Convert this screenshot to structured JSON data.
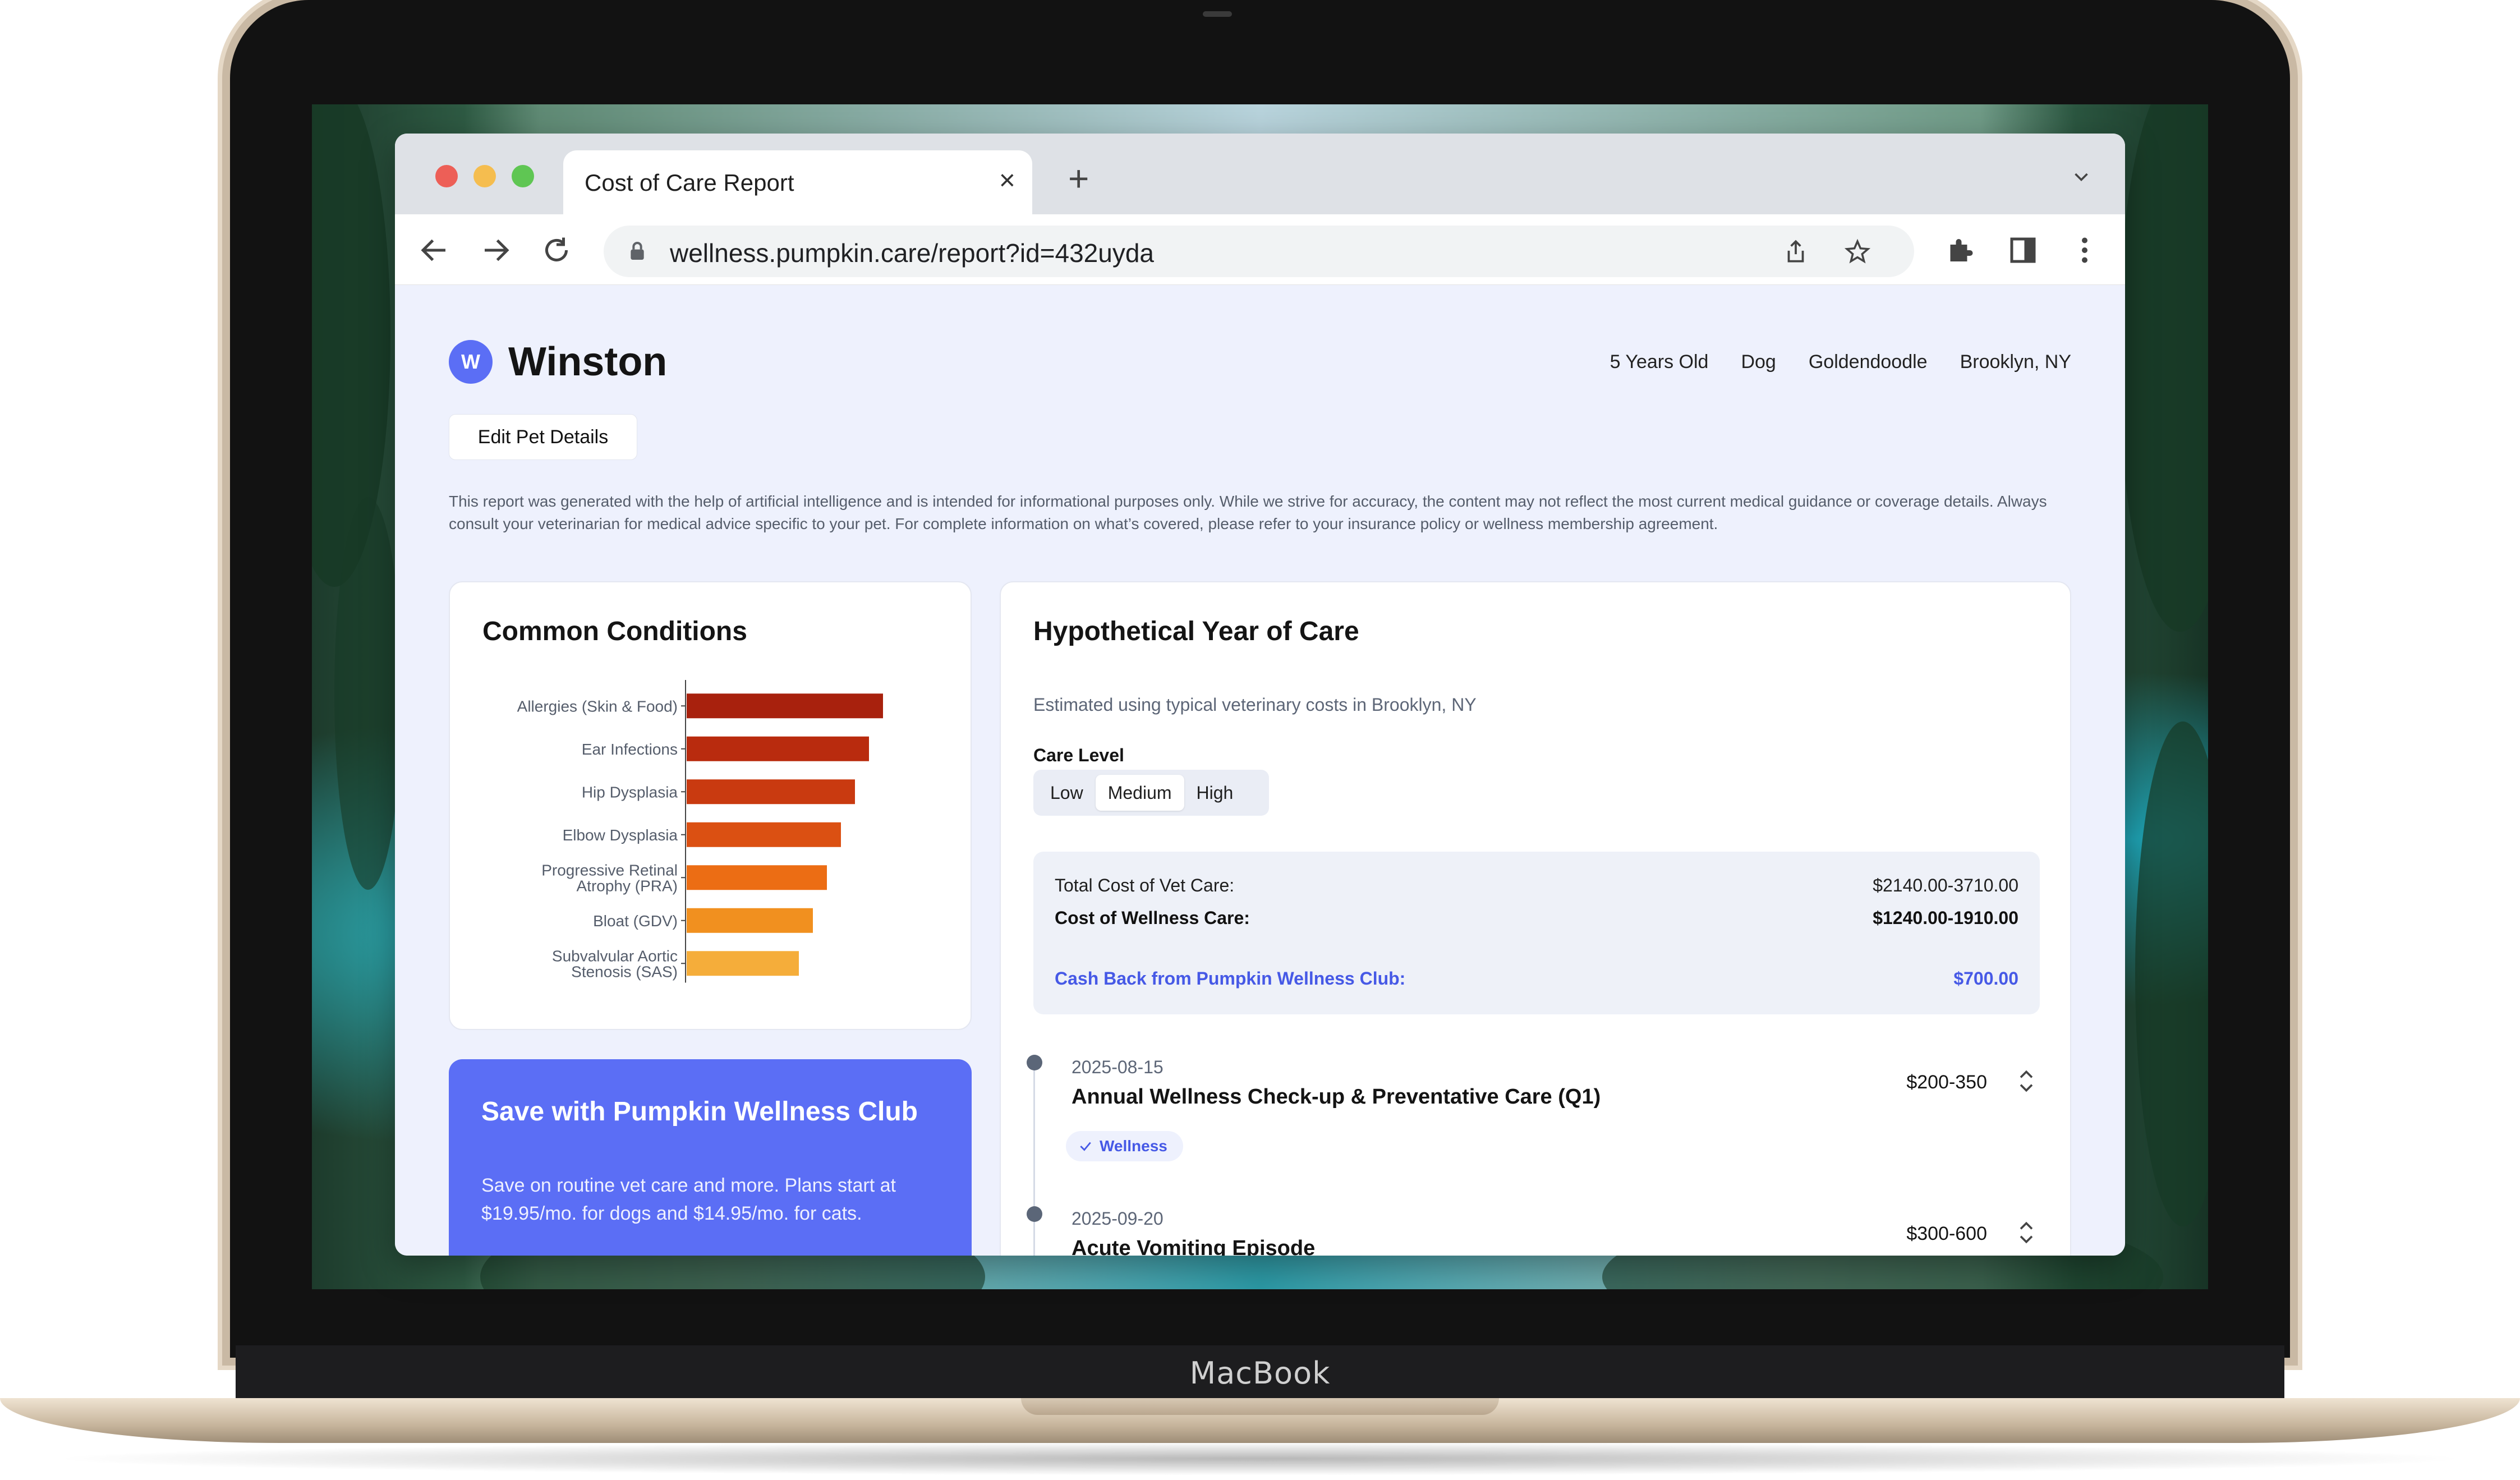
{
  "device": {
    "brand_label": "MacBook"
  },
  "browser": {
    "tab_title": "Cost of Care Report",
    "url": "wellness.pumpkin.care/report?id=432uyda"
  },
  "pet": {
    "initial": "W",
    "name": "Winston",
    "facts": [
      "5 Years Old",
      "Dog",
      "Goldendoodle",
      "Brooklyn, NY"
    ],
    "edit_label": "Edit Pet Details"
  },
  "disclaimer": "This report was generated with the help of artificial intelligence and is intended for informational purposes only. While we strive for accuracy, the content may not reflect the most current medical guidance or coverage details. Always consult your veterinarian for medical advice specific to your pet. For complete information on what’s covered, please refer to your insurance policy or wellness membership agreement.",
  "conditions": {
    "title": "Common Conditions",
    "chart_data": {
      "type": "bar",
      "orientation": "horizontal",
      "categories": [
        [
          "Allergies (Skin & Food)"
        ],
        [
          "Ear Infections"
        ],
        [
          "Hip Dysplasia"
        ],
        [
          "Elbow Dysplasia"
        ],
        [
          "Progressive Retinal",
          "Atrophy (PRA)"
        ],
        [
          "Bloat (GDV)"
        ],
        [
          "Subvalvular Aortic",
          "Stenosis (SAS)"
        ]
      ],
      "values": [
        7,
        6.5,
        6,
        5.5,
        5,
        4.5,
        4
      ],
      "xlim": [
        0,
        8
      ],
      "colors": [
        "#a8210d",
        "#b92b0e",
        "#c93a10",
        "#db5012",
        "#ec6d14",
        "#f1901f",
        "#f5ad3a"
      ],
      "grid": false,
      "legend": "none"
    }
  },
  "promo": {
    "title": "Save with Pumpkin Wellness Club",
    "text": "Save on routine vet care and more. Plans start at $19.95/mo. for dogs and $14.95/mo. for cats."
  },
  "year": {
    "title": "Hypothetical Year of Care",
    "subtitle": "Estimated using typical veterinary costs in Brooklyn, NY",
    "care_level_label": "Care Level",
    "care_levels": [
      "Low",
      "Medium",
      "High"
    ],
    "selected_level": "Medium",
    "totals": {
      "vet_label": "Total Cost of Vet Care:",
      "vet_value": "$2140.00-3710.00",
      "wellness_label": "Cost of Wellness Care:",
      "wellness_value": "$1240.00-1910.00",
      "cashback_label": "Cash Back from Pumpkin Wellness Club:",
      "cashback_value": "$700.00"
    },
    "events": [
      {
        "date": "2025-08-15",
        "title": "Annual Wellness Check-up & Preventative Care (Q1)",
        "price": "$200-350",
        "badge": "Wellness"
      },
      {
        "date": "2025-09-20",
        "title": "Acute Vomiting Episode",
        "price": "$300-600"
      }
    ]
  },
  "colors": {
    "accent": "#5b6ef5",
    "link": "#4659e6",
    "page_bg": "#eef1fd"
  }
}
